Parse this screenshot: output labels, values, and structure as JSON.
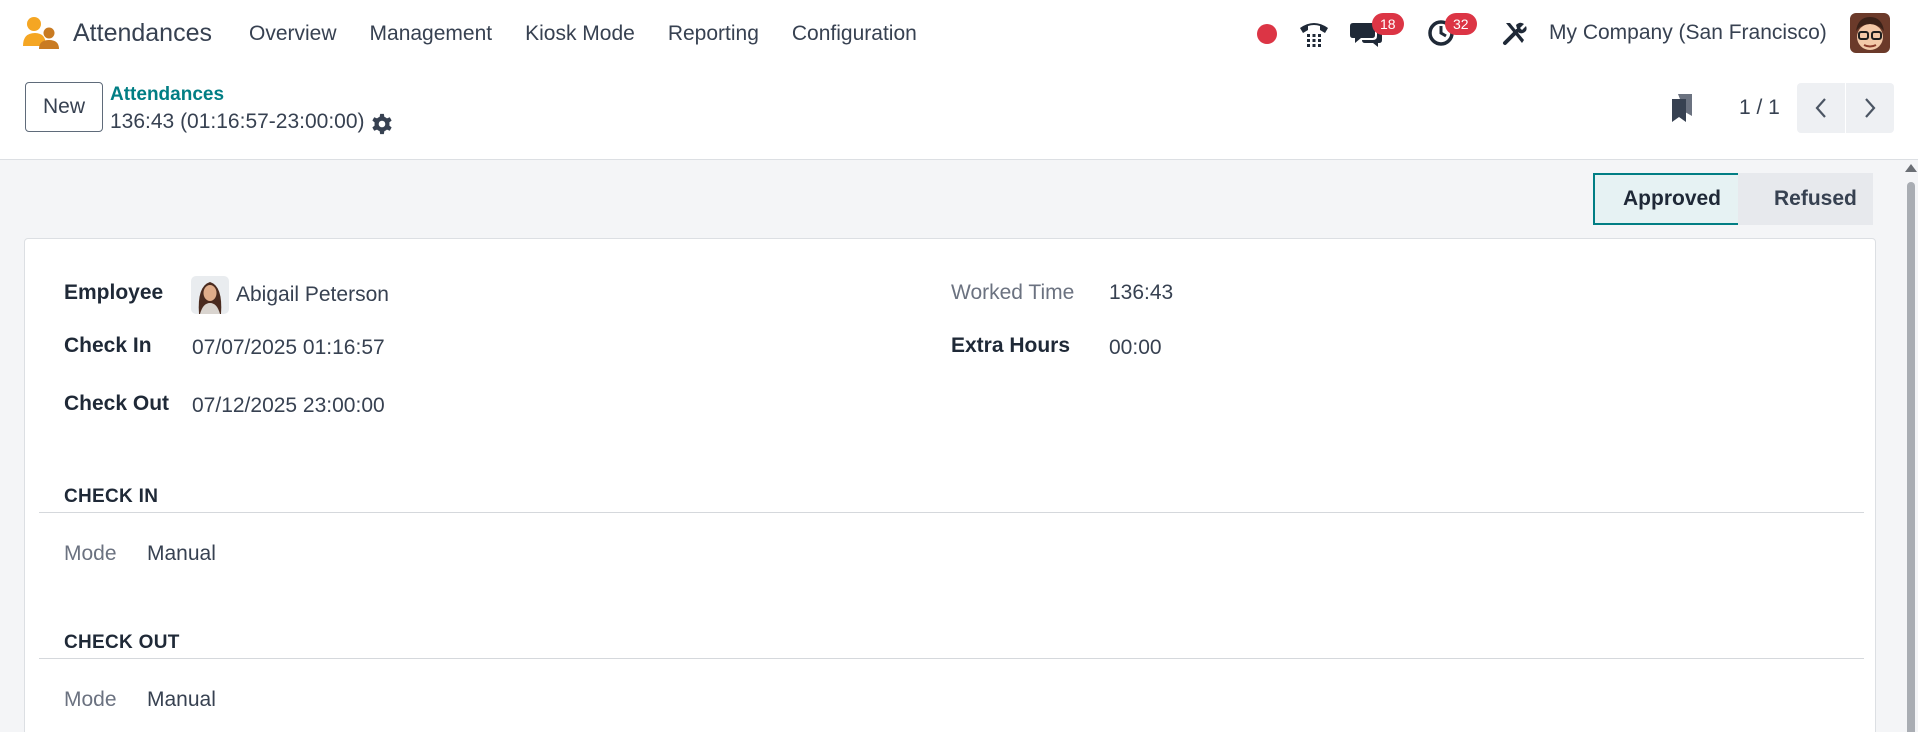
{
  "navbar": {
    "app_name": "Attendances",
    "menu": [
      "Overview",
      "Management",
      "Kiosk Mode",
      "Reporting",
      "Configuration"
    ],
    "messages_badge": "18",
    "activities_badge": "32",
    "company": "My Company (San Francisco)"
  },
  "control": {
    "new_label": "New",
    "breadcrumb": "Attendances",
    "record_title": "136:43 (01:16:57-23:00:00)",
    "pager": "1 / 1"
  },
  "status": {
    "stages": [
      "Approved",
      "Refused"
    ],
    "active": "Approved"
  },
  "form": {
    "employee_label": "Employee",
    "employee_value": "Abigail Peterson",
    "check_in_label": "Check In",
    "check_in_value": "07/07/2025 01:16:57",
    "check_out_label": "Check Out",
    "check_out_value": "07/12/2025 23:00:00",
    "worked_time_label": "Worked Time",
    "worked_time_value": "136:43",
    "extra_hours_label": "Extra Hours",
    "extra_hours_value": "00:00",
    "section_check_in": "CHECK IN",
    "section_check_out": "CHECK OUT",
    "mode_label": "Mode",
    "check_in_mode": "Manual",
    "check_out_mode": "Manual"
  },
  "colors": {
    "accent": "#017e84",
    "badge": "#dc3545",
    "logo_orange": "#f5a623"
  },
  "icons": [
    "app-logo-icon",
    "recording-icon",
    "phone-icon",
    "chat-icon",
    "clock-icon",
    "tools-icon",
    "gear-icon",
    "pager-icon",
    "chevron-left-icon",
    "chevron-right-icon"
  ]
}
